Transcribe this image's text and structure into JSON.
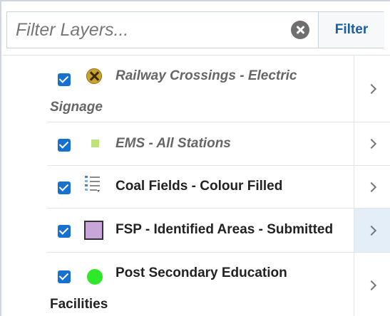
{
  "filter": {
    "placeholder": "Filter Layers...",
    "button_label": "Filter"
  },
  "layers": [
    {
      "line1": "Railway Crossings - Electric",
      "line2": "Signage",
      "checked": true,
      "icon": "railway-crossing-icon",
      "dimmed": true
    },
    {
      "line1": "EMS - All Stations",
      "line2": "",
      "checked": true,
      "icon": "green-square-icon",
      "dimmed": true
    },
    {
      "line1": "Coal Fields - Colour Filled",
      "line2": "",
      "checked": true,
      "icon": "legend-list-icon",
      "dimmed": false
    },
    {
      "line1": "FSP - Identified Areas - Submitted",
      "line2": "",
      "checked": true,
      "icon": "purple-square-icon",
      "dimmed": false,
      "selected": true
    },
    {
      "line1": "Post Secondary Education",
      "line2": "Facilities",
      "checked": true,
      "icon": "green-circle-icon",
      "dimmed": false
    }
  ],
  "colors": {
    "checkbox": "#1670d2",
    "filter_button_text": "#1a5fa3",
    "selected_row": "#e3eef8"
  }
}
